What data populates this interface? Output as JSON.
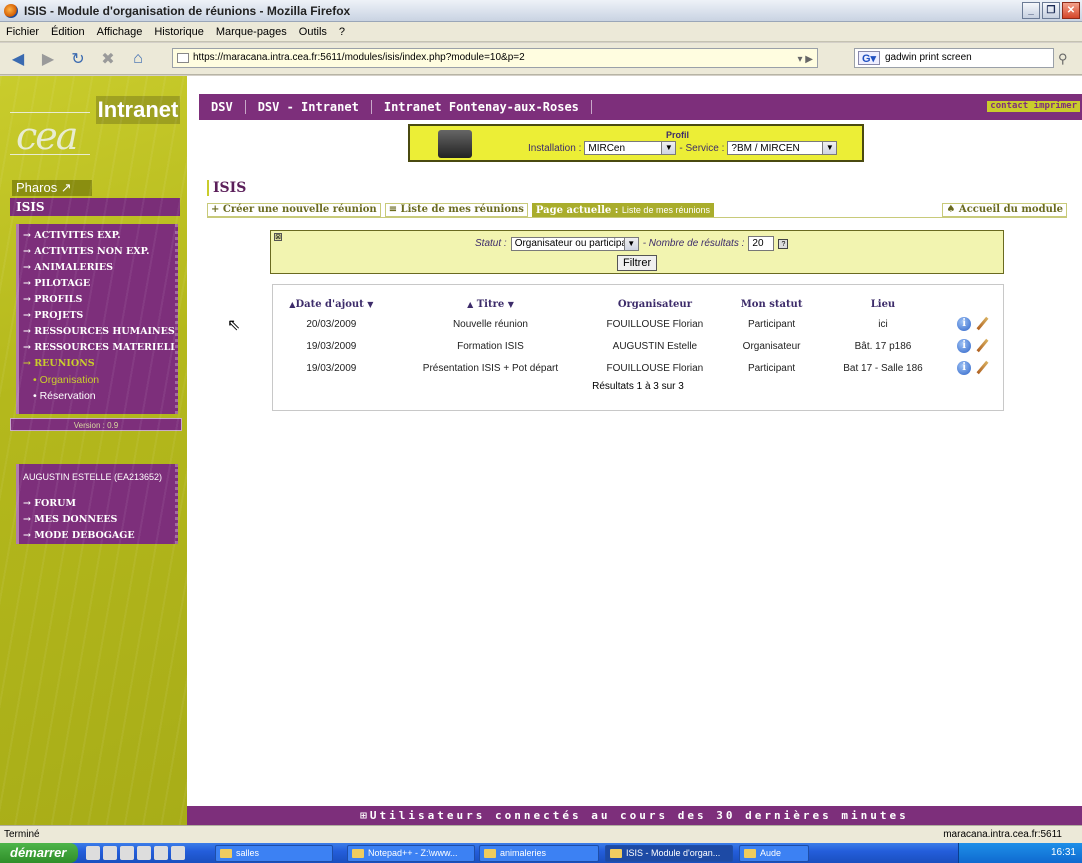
{
  "window": {
    "title": "ISIS - Module d'organisation de réunions - Mozilla Firefox"
  },
  "menu": [
    "Fichier",
    "Édition",
    "Affichage",
    "Historique",
    "Marque-pages",
    "Outils",
    "?"
  ],
  "browser": {
    "url": "https://maracana.intra.cea.fr:5611/modules/isis/index.php?module=10&p=2",
    "search_value": "gadwin print screen"
  },
  "sidebar": {
    "intranet_label": "Intranet",
    "cea_logo": "cea",
    "pharos": "Pharos ↗",
    "isis": "ISIS",
    "menu_items": [
      {
        "label": "→ ACTIVITES EXP."
      },
      {
        "label": "→ ACTIVITES NON EXP."
      },
      {
        "label": "→ ANIMALERIES"
      },
      {
        "label": "→ PILOTAGE"
      },
      {
        "label": "→ PROFILS"
      },
      {
        "label": "→ PROJETS"
      },
      {
        "label": "→ RESSOURCES HUMAINES"
      },
      {
        "label": "→ RESSOURCES MATERIELLES"
      },
      {
        "label": "→ REUNIONS"
      }
    ],
    "sub_items": [
      {
        "label": "• Organisation"
      },
      {
        "label": "• Réservation"
      }
    ],
    "version": "Version : 0.9",
    "user": "AUGUSTIN ESTELLE (EA213652)",
    "user_items": [
      {
        "label": "→ FORUM"
      },
      {
        "label": "→ MES DONNEES"
      },
      {
        "label": "→ MODE DEBOGAGE"
      }
    ]
  },
  "header": {
    "crumbs": [
      "DSV",
      "DSV - Intranet",
      "Intranet Fontenay-aux-Roses"
    ],
    "right_links": "contact  imprimer"
  },
  "profil": {
    "title": "Profil",
    "installation_label": "Installation :",
    "installation_value": "MIRCen",
    "service_label": "- Service :",
    "service_value": "?BM / MIRCEN"
  },
  "module": {
    "title": "ISIS",
    "tab_create": "+ Créer une nouvelle réunion",
    "tab_list": "≡ Liste de mes réunions",
    "tab_current_label": "Page actuelle :",
    "tab_current_value": "Liste de mes réunions",
    "tab_home": "♠ Accueil du module"
  },
  "filter": {
    "statut_label": "Statut :",
    "statut_value": "Organisateur ou participant",
    "nb_label": "- Nombre de résultats :",
    "nb_value": "20",
    "button": "Filtrer"
  },
  "table": {
    "headers": [
      "Date d'ajout",
      "Titre",
      "Organisateur",
      "Mon statut",
      "Lieu"
    ],
    "rows": [
      {
        "date": "20/03/2009",
        "titre": "Nouvelle réunion",
        "organisateur": "FOUILLOUSE Florian",
        "statut": "Participant",
        "lieu": "ici"
      },
      {
        "date": "19/03/2009",
        "titre": "Formation ISIS",
        "organisateur": "AUGUSTIN Estelle",
        "statut": "Organisateur",
        "lieu": "Bât. 17 p186"
      },
      {
        "date": "19/03/2009",
        "titre": "Présentation ISIS + Pot départ",
        "organisateur": "FOUILLOUSE Florian",
        "statut": "Participant",
        "lieu": "Bat 17 - Salle 186"
      }
    ],
    "count": "Résultats 1 à 3 sur 3"
  },
  "footer": {
    "connected": "⊞Utilisateurs connectés au cours des 30 dernières minutes"
  },
  "status": {
    "left": "Terminé",
    "right": "maracana.intra.cea.fr:5611"
  },
  "taskbar": {
    "start": "démarrer",
    "tasks": [
      "salles",
      "Notepad++ - Z:\\www...",
      "animaleries",
      "ISIS - Module d'organ...",
      "Aude"
    ],
    "clock": "16:31"
  }
}
